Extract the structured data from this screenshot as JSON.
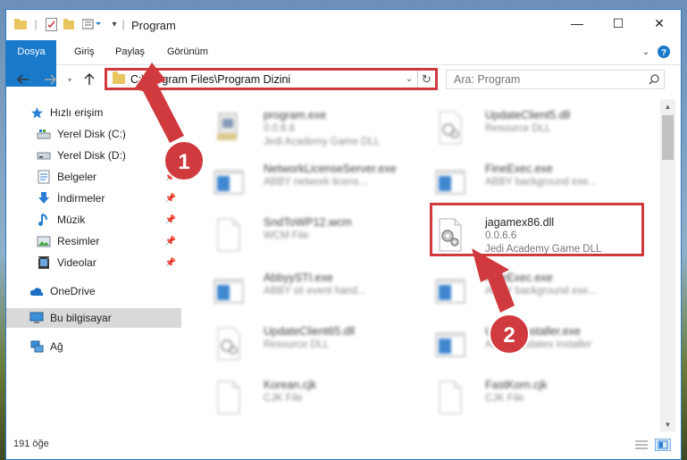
{
  "window": {
    "title": "Program",
    "controls": {
      "minimize": "—",
      "maximize": "☐",
      "close": "✕"
    }
  },
  "ribbon": {
    "tabs": [
      "Dosya",
      "Giriş",
      "Paylaş",
      "Görünüm"
    ]
  },
  "address": {
    "path": "C:\\Program Files\\Program Dizini",
    "search_placeholder": "Ara: Program"
  },
  "nav": {
    "quick_access": "Hızlı erişim",
    "items": [
      {
        "label": "Yerel Disk (C:)",
        "icon": "drive-c-icon",
        "pinned": false
      },
      {
        "label": "Yerel Disk (D:)",
        "icon": "drive-d-icon",
        "pinned": false
      },
      {
        "label": "Belgeler",
        "icon": "documents-icon",
        "pinned": true
      },
      {
        "label": "İndirmeler",
        "icon": "downloads-icon",
        "pinned": true
      },
      {
        "label": "Müzik",
        "icon": "music-icon",
        "pinned": true
      },
      {
        "label": "Resimler",
        "icon": "pictures-icon",
        "pinned": true
      },
      {
        "label": "Videolar",
        "icon": "videos-icon",
        "pinned": true
      }
    ],
    "onedrive": "OneDrive",
    "this_pc": "Bu bilgisayar",
    "network": "Ağ"
  },
  "files": [
    {
      "name": "program.exe",
      "l2": "0.0.6.6",
      "l3": "Jedi Academy Game DLL",
      "icon": "app-icon"
    },
    {
      "name": "UpdateClient5.dll",
      "l2": "Resource DLL",
      "l3": "",
      "icon": "dll-icon"
    },
    {
      "name": "NetworkLicenseServer.exe",
      "l2": "ABBY network licens...",
      "l3": "",
      "icon": "window-icon"
    },
    {
      "name": "FineExec.exe",
      "l2": "ABBY background exe...",
      "l3": "",
      "icon": "window-icon"
    },
    {
      "name": "SndToWP12.wcm",
      "l2": "WCM File",
      "l3": "",
      "icon": "blank-file-icon"
    },
    {
      "name": "jagamex86.dll",
      "l2": "0.0.6.6",
      "l3": "Jedi Academy Game DLL",
      "icon": "dll-gears-icon"
    },
    {
      "name": "AbbyySTI.exe",
      "l2": "ABBY sti event hand...",
      "l3": "",
      "icon": "window-icon"
    },
    {
      "name": "FineExec.exe",
      "l2": "ABBY background exe...",
      "l3": "",
      "icon": "window-icon"
    },
    {
      "name": "UpdateClient65.dll",
      "l2": "Resource DLL",
      "l3": "",
      "icon": "dll-icon"
    },
    {
      "name": "UpdateInstaller.exe",
      "l2": "ABBY Updates installer",
      "l3": "",
      "icon": "window-icon"
    },
    {
      "name": "Korean.cjk",
      "l2": "CJK File",
      "l3": "",
      "icon": "blank-file-icon"
    },
    {
      "name": "FastKorn.cjk",
      "l2": "CJK File",
      "l3": "",
      "icon": "blank-file-icon"
    }
  ],
  "status": {
    "count": "191 öğe"
  },
  "annotations": {
    "marker1": "1",
    "marker2": "2",
    "color": "#d03a3f"
  }
}
